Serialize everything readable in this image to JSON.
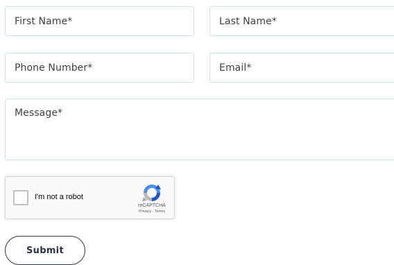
{
  "form": {
    "first_name": {
      "placeholder": "First Name*",
      "value": ""
    },
    "last_name": {
      "placeholder": "Last Name*",
      "value": ""
    },
    "phone": {
      "placeholder": "Phone Number*",
      "value": ""
    },
    "email": {
      "placeholder": "Email*",
      "value": ""
    },
    "message": {
      "placeholder": "Message*",
      "value": ""
    },
    "field_border_color": "#c9e4e6"
  },
  "captcha": {
    "checkbox_label": "I'm not a robot",
    "checked": false,
    "brand": "reCAPTCHA",
    "privacy_link": "Privacy",
    "separator": " - ",
    "terms_link": "Terms",
    "logo_icon": "recaptcha-logo-icon"
  },
  "submit": {
    "label": "Submit",
    "text_color": "#2b3345"
  }
}
